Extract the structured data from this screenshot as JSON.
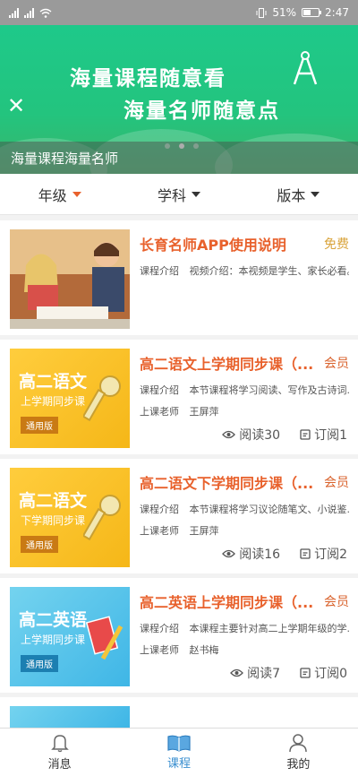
{
  "status_bar": {
    "battery": "51%",
    "time": "2:47"
  },
  "banner": {
    "line1": "海量课程随意看",
    "line2": "海量名师随意点",
    "caption": "海量课程海量名师"
  },
  "filters": [
    {
      "label": "年级",
      "active": true
    },
    {
      "label": "学科",
      "active": false
    },
    {
      "label": "版本",
      "active": false
    }
  ],
  "courses": [
    {
      "title": "长育名师APP使用说明",
      "tag": "免费",
      "intro_key": "课程介绍",
      "intro": "视频介绍：本视频是学生、家长必看。",
      "teacher_key": "",
      "teacher": "",
      "reads": "",
      "subs": ""
    },
    {
      "title": "高二语文上学期同步课（...",
      "tag": "会员",
      "intro_key": "课程介绍",
      "intro": "本节课程将学习阅读、写作及古诗词...",
      "teacher_key": "上课老师",
      "teacher": "王屏萍",
      "reads": "阅读30",
      "subs": "订阅1",
      "thumb": {
        "big": "高二语文",
        "sub": "上学期同步课",
        "badge": "通用版"
      }
    },
    {
      "title": "高二语文下学期同步课（...",
      "tag": "会员",
      "intro_key": "课程介绍",
      "intro": "本节课程将学习议论随笔文、小说鉴...",
      "teacher_key": "上课老师",
      "teacher": "王屏萍",
      "reads": "阅读16",
      "subs": "订阅2",
      "thumb": {
        "big": "高二语文",
        "sub": "下学期同步课",
        "badge": "通用版"
      }
    },
    {
      "title": "高二英语上学期同步课（...",
      "tag": "会员",
      "intro_key": "课程介绍",
      "intro": "本课程主要针对高二上学期年级的学...",
      "teacher_key": "上课老师",
      "teacher": "赵书梅",
      "reads": "阅读7",
      "subs": "订阅0",
      "thumb": {
        "big": "高二英语",
        "sub": "上学期同步课",
        "badge": "通用版"
      }
    }
  ],
  "bottom_nav": [
    {
      "label": "消息",
      "icon": "bell-icon"
    },
    {
      "label": "课程",
      "icon": "book-icon"
    },
    {
      "label": "我的",
      "icon": "person-icon"
    }
  ]
}
